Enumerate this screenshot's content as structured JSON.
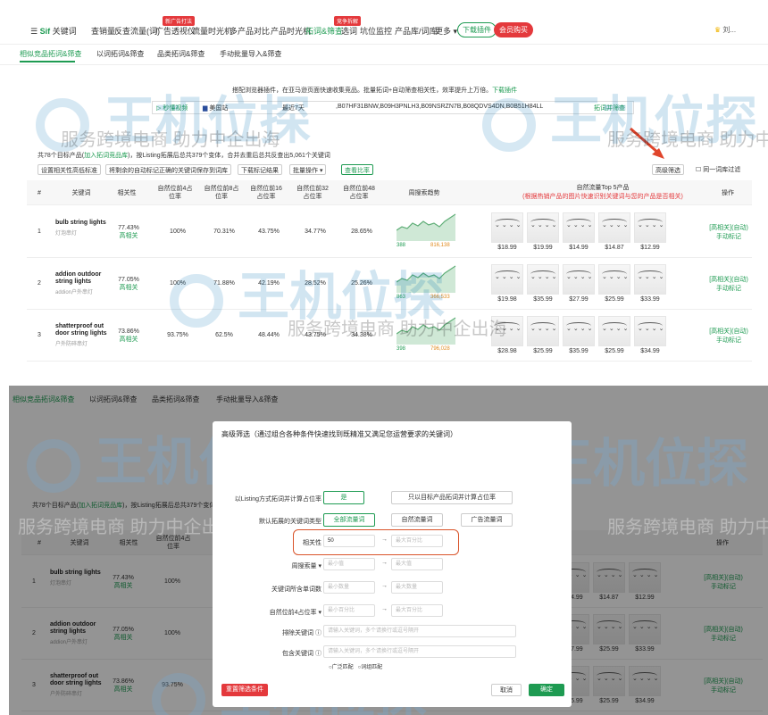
{
  "nav": {
    "logo_prefix": "Sif",
    "logo_suffix": "关键词",
    "items": [
      "查销量",
      "反查流量(词)",
      "广告透视仪",
      "流量时光机",
      "多产品对比",
      "产品时光机",
      "拓词&筛查",
      "选词",
      "坑位监控",
      "产品库/词库",
      "更多"
    ],
    "tags": [
      "新广告打法",
      "竞争拆解"
    ],
    "download_label": "下载插件",
    "vip_label": "会员购买",
    "user_label": "刘..."
  },
  "subtabs": [
    "相似竞品拓词&筛查",
    "以词拓词&筛查",
    "品类拓词&筛查",
    "手动批量导入&筛查"
  ],
  "hint": {
    "text": "搭配浏览器插件，在亚马逊页面快速收集竞品。批量拓词+自动筛查相关性，效率提升上万倍。",
    "link": "下载插件"
  },
  "search": {
    "history_label": "秒懂视频",
    "site_label": "美国站",
    "period_label": "最近7天",
    "asins": ",B07HF31BNW,B09H3PNLH3,B09NSRZN7B,B08QDVS4DN,B0B51H84LL",
    "submit_label": "拓词并筛查"
  },
  "summary": {
    "prefix": "共78个目标产品(",
    "link": "加入拓词竞品库",
    "suffix": ")，按Listing拓展后总共379个变体，合并去重后总共反查出5,061个关键词"
  },
  "toolbar": {
    "buttons": [
      "设置相关性高低标准",
      "将剩余的自动标记正确的关键词保存到词库",
      "下载标记结果",
      "批量操作",
      "查看比率"
    ],
    "advanced_label": "高级筛选",
    "dedupe_label": "同一词库过滤"
  },
  "table": {
    "headers": [
      "#",
      "关键词",
      "相关性",
      "自然位前4占位率",
      "自然位前8占位率",
      "自然位前16占位率",
      "自然位前32占位率",
      "自然位前48占位率",
      "周搜索趋势",
      "自然流量Top 5产品",
      "操作"
    ],
    "top5_note": "(根据热销产品的图片快速识别关键词与您的产品是否相关)",
    "rows": [
      {
        "idx": "1",
        "kw": "bulb string lights",
        "kw_cn": "灯泡串灯",
        "rel": "77.43%",
        "rel_tag": "高相关",
        "p4": "100%",
        "p8": "70.31%",
        "p16": "43.75%",
        "p32": "34.77%",
        "p48": "28.65%",
        "trend_min": "388",
        "trend_max": "816,138",
        "prices": [
          "$18.99",
          "$19.99",
          "$14.99",
          "$14.87",
          "$12.99"
        ],
        "op1": "[高相关](自动)",
        "op2": "手动标记"
      },
      {
        "idx": "2",
        "kw": "addion outdoor string lights",
        "kw_cn": "addion户外串灯",
        "rel": "77.05%",
        "rel_tag": "高相关",
        "p4": "100%",
        "p8": "71.88%",
        "p16": "42.19%",
        "p32": "28.52%",
        "p48": "25.26%",
        "trend_min": "863",
        "trend_max": "366,533",
        "prices": [
          "$19.98",
          "$35.99",
          "$27.99",
          "$25.99",
          "$33.99"
        ],
        "op1": "[高相关](自动)",
        "op2": "手动标记"
      },
      {
        "idx": "3",
        "kw": "shatterproof out door string lights",
        "kw_cn": "户外防碎串灯",
        "rel": "73.86%",
        "rel_tag": "高相关",
        "p4": "93.75%",
        "p8": "62.5%",
        "p16": "48.44%",
        "p32": "43.75%",
        "p48": "34.38%",
        "trend_min": "398",
        "trend_max": "796,028",
        "prices": [
          "$28.98",
          "$25.99",
          "$35.99",
          "$25.99",
          "$34.99"
        ],
        "op1": "[高相关](自动)",
        "op2": "手动标记"
      }
    ]
  },
  "watermark": {
    "big": "王机位探",
    "sub": "服务跨境电商 助力中企出海"
  },
  "modal": {
    "title": "高级筛选（通过组合各种条件快速找到既精准又满足您运营要求的关键词）",
    "rows": {
      "listing_label": "以Listing方式拓词并计算占位率",
      "listing_yes": "是",
      "listing_no": "只以目标产品拓词并计算占位率",
      "type_label": "默认拓展的关键词类型",
      "type_all": "全部流量词",
      "type_natural": "自然流量词",
      "type_ad": "广告流量词",
      "rel_label": "相关性",
      "rel_value": "50",
      "rel_max_ph": "最大百分比",
      "search_label": "周搜索量",
      "min_ph": "最小值",
      "max_ph": "最大值",
      "products_label": "关键词所含单词数",
      "min_count_ph": "最小数量",
      "max_count_ph": "最大数量",
      "rank_label": "自然位前4占位率",
      "min_pct_ph": "最小百分比",
      "max_pct_ph": "最大百分比",
      "exclude_label": "排除关键词",
      "exclude_ph": "请输入关键词，多个请换行或逗号隔开",
      "include_label": "包含关键词",
      "include_ph": "请输入关键词，多个请换行或逗号隔开",
      "chip1": "广泛匹配",
      "chip2": "词组匹配"
    },
    "reset_label": "重置筛选条件",
    "cancel_label": "取消",
    "ok_label": "确定"
  }
}
